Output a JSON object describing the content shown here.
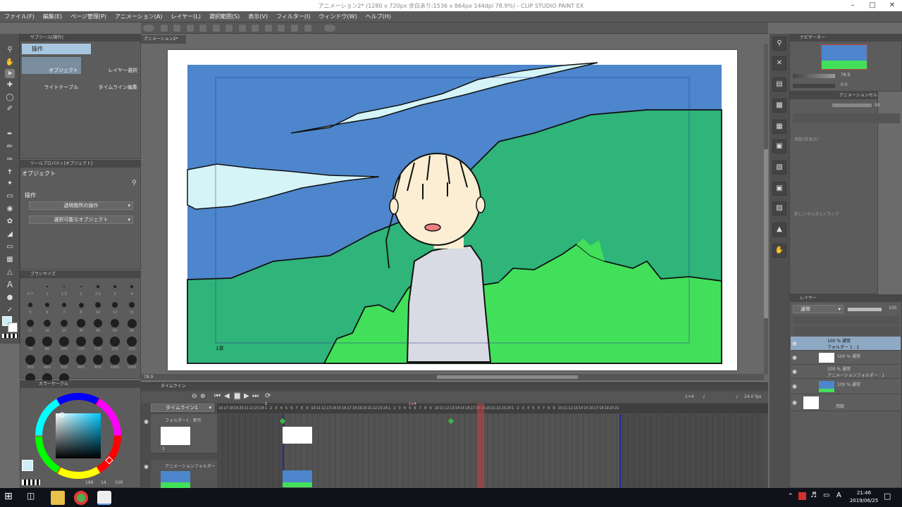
{
  "window": {
    "title": "アニメーション2* (1280 x 720px 余白あり:1536 x 864px 144dpi 78.9%) - CLIP STUDIO PAINT EX"
  },
  "menu": [
    "ファイル(F)",
    "編集(E)",
    "ページ管理(P)",
    "アニメーション(A)",
    "レイヤー(L)",
    "選択範囲(S)",
    "表示(V)",
    "フィルター(I)",
    "ウィンドウ(W)",
    "ヘルプ(H)"
  ],
  "subtool": {
    "header": "サブツール[操作]",
    "group": "操作",
    "items": [
      "オブジェクト",
      "レイヤー選択",
      "ライトテーブル",
      "タイムライン編集"
    ]
  },
  "toolprop": {
    "header": "ツールプロパティ[オブジェクト]",
    "name": "オブジェクト",
    "section": "操作",
    "dropdown1": "透明箇所の操作",
    "dropdown2": "選択可能なオブジェクト"
  },
  "brushsize": {
    "header": "ブラシサイズ",
    "sizes": [
      "0.7",
      "1",
      "1.5",
      "2",
      "2.5",
      "3",
      "4",
      "5",
      "6",
      "7",
      "8",
      "10",
      "12",
      "15",
      "17",
      "20",
      "25",
      "30",
      "40",
      "50",
      "60",
      "70",
      "80",
      "100",
      "120",
      "150",
      "200",
      "250",
      "300",
      "400",
      "500",
      "600",
      "800",
      "1000",
      "1200",
      "1500",
      "1700",
      "2000"
    ]
  },
  "color": {
    "header": "カラーサークル",
    "readout": [
      "188",
      "14",
      "100"
    ]
  },
  "canvas": {
    "tab": "アニメーション2*",
    "frame_label": "1章",
    "zoom": "78.9"
  },
  "timeline": {
    "header": "タイムライン",
    "name": "タイムライン1",
    "frame_readout": "1+4",
    "separator": "/",
    "fps": "24.0 fps",
    "track1": "フォルダー1 : 実写",
    "track2": "アニメーションフォルダー",
    "thumb_label": "1",
    "ruler_pre": [
      "16",
      "17",
      "18",
      "19",
      "20",
      "21",
      "22",
      "23",
      "24"
    ],
    "ruler_main1": [
      "1",
      "2",
      "3",
      "4",
      "5",
      "6",
      "7",
      "8",
      "9",
      "10",
      "11",
      "12",
      "13",
      "14",
      "15",
      "16",
      "17",
      "18",
      "19",
      "20",
      "21",
      "22",
      "23",
      "24"
    ],
    "ruler_main2": [
      "1",
      "2",
      "3",
      "4",
      "5",
      "6",
      "7",
      "8",
      "9",
      "10",
      "11",
      "12",
      "13",
      "14",
      "15",
      "16",
      "17",
      "18",
      "19",
      "20",
      "21",
      "22",
      "23",
      "24"
    ],
    "ruler_post": [
      "1",
      "2",
      "3",
      "4",
      "5",
      "6",
      "7",
      "8",
      "9",
      "10",
      "11",
      "12",
      "13",
      "14",
      "15",
      "16",
      "17",
      "18",
      "19",
      "20",
      "21"
    ],
    "marker1": "1",
    "marker2": "1+4"
  },
  "navigator": {
    "header": "ナビゲーター",
    "zoom": "78.9",
    "angle": "0.0"
  },
  "animcel": {
    "header": "アニメーションセル",
    "value": "50",
    "layer_label": "用紙(非表示)",
    "info": "新しいセルを1トラック"
  },
  "layers": {
    "header": "レイヤー",
    "blend": "通常",
    "opacity": "100",
    "rows": [
      {
        "line1": "100 % 通常",
        "line2": "フォルダー 1 : 1",
        "type": "folder",
        "selected": true
      },
      {
        "line1": "100 % 通常",
        "line2": "",
        "type": "layer",
        "selected": false
      },
      {
        "line1": "100 % 通常",
        "line2": "アニメーションフォルダー : 1",
        "type": "folder",
        "selected": false
      },
      {
        "line1": "100 % 通常",
        "line2": "",
        "type": "layer",
        "selected": false
      },
      {
        "line1": "用紙",
        "line2": "",
        "type": "paper",
        "selected": false
      }
    ]
  },
  "taskbar": {
    "time": "21:46",
    "date": "2019/06/25",
    "ime": "A"
  },
  "colors": {
    "sky": "#4d86cc",
    "mountain": "#2fb47a",
    "bush": "#42e05a",
    "cloud": "#d4f4f8",
    "skin": "#fbeed2",
    "shirt": "#d8dbe3",
    "playhead": "#c84040",
    "accent": "#2a2a9a"
  }
}
